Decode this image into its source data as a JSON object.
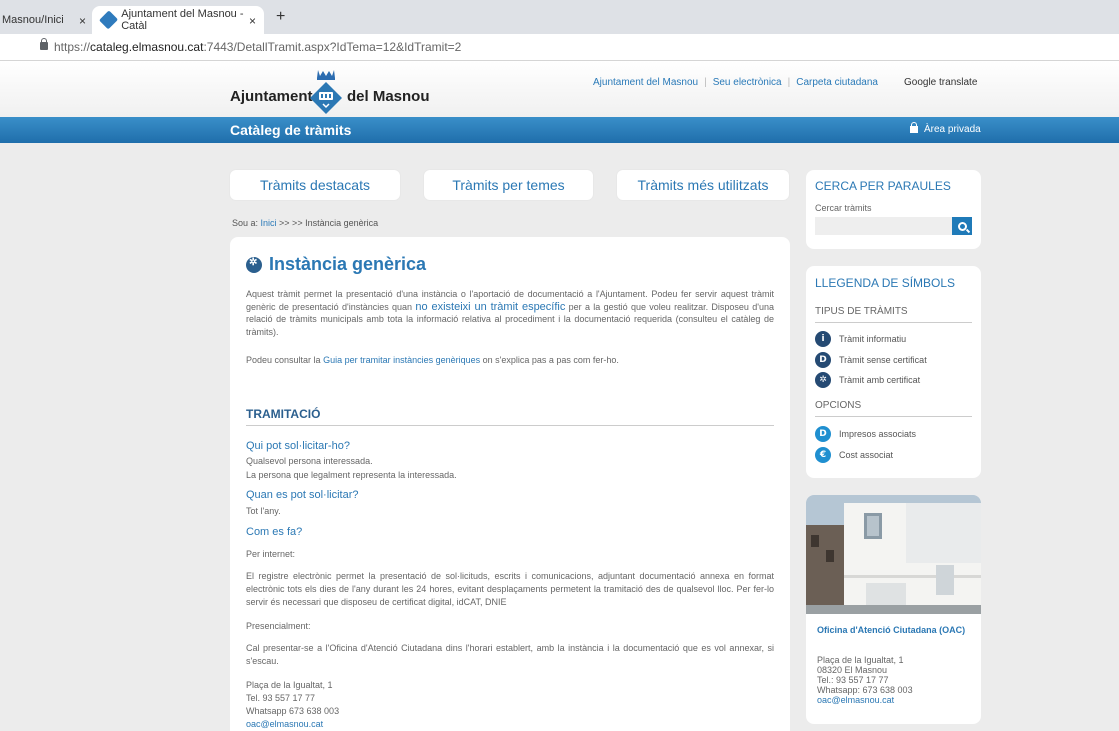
{
  "browser": {
    "tab1_title": "Masnou/Inici",
    "tab2_title": "Ajuntament del Masnou - Catàl",
    "close_glyph": "×",
    "new_tab_glyph": "+",
    "url_prefix": "https://",
    "url_host": "cataleg.elmasnou.cat",
    "url_rest": ":7443/DetallTramit.aspx?IdTema=12&IdTramit=2"
  },
  "header": {
    "logo_left": "Ajuntament",
    "logo_right": "del Masnou",
    "links": [
      "Ajuntament del Masnou",
      "Seu electrònica",
      "Carpeta ciutadana"
    ],
    "translate": "Google translate"
  },
  "bar": {
    "title": "Catàleg de tràmits",
    "private": "Àrea privada"
  },
  "nav": {
    "btn1": "Tràmits destacats",
    "btn2": "Tràmits per temes",
    "btn3": "Tràmits més utilitzats"
  },
  "breadcrumb": {
    "prefix": "Sou a: ",
    "home": "Inici",
    "rest": " >> >> Instància genèrica"
  },
  "main": {
    "title": "Instància genèrica",
    "intro_a": "Aquest tràmit permet la presentació d'una instància o l'aportació de documentació a l'Ajuntament. Podeu fer servir aquest tràmit genèric de presentació d'instàncies quan ",
    "intro_hl": "no existeixi un tràmit específic",
    "intro_b": " per a la gestió que voleu realitzar. Disposeu d'una relació de tràmits municipals amb tota la informació relativa al procediment i la documentació requerida (consulteu el catàleg de tràmits).",
    "intro2_a": "Podeu consultar la ",
    "intro2_link": "Guia per tramitar instàncies genèriques",
    "intro2_b": " on s'explica pas a pas com fer-ho.",
    "section": "TRAMITACIÓ",
    "q1": "Qui pot sol·licitar-ho?",
    "a1_line1": "Qualsevol persona interessada.",
    "a1_line2": "La persona que legalment representa la interessada.",
    "q2": "Quan es pot sol·licitar?",
    "a2": "Tot l'any.",
    "q3": "Com es fa?",
    "a3_internet": "Per internet:",
    "a3_internet_text": "El registre electrònic permet la presentació de sol·licituds, escrits i comunicacions, adjuntant documentació annexa en format electrònic tots els dies de l'any durant les 24 hores, evitant desplaçaments permetent la tramitació des de qualsevol lloc. Per fer-lo servir és necessari que disposeu de certificat digital, idCAT, DNIE",
    "a3_presencial": "Presencialment:",
    "a3_presencial_text": "Cal presentar-se a l'Oficina d'Atenció Ciutadana dins l'horari establert, amb la instància i la documentació que es vol annexar, si s'escau.",
    "addr1": "Plaça de la Igualtat, 1",
    "addr2": "Tel. 93 557 17 77",
    "addr3": "Whatsapp 673 638 003",
    "addr4": "oac@elmasnou.cat"
  },
  "search": {
    "heading": "CERCA PER PARAULES",
    "label": "Cercar tràmits",
    "placeholder": ""
  },
  "legend": {
    "heading": "LLEGENDA DE SÍMBOLS",
    "types_heading": "TIPUS DE TRÀMITS",
    "items": [
      {
        "icon": "info-icon",
        "glyph": "i",
        "label": "Tràmit informatiu"
      },
      {
        "icon": "document-icon",
        "glyph": "D",
        "label": "Tràmit sense certificat"
      },
      {
        "icon": "gear-icon",
        "glyph": "✲",
        "label": "Tràmit amb certificat"
      }
    ],
    "options_heading": "OPCIONS",
    "options": [
      {
        "icon": "forms-icon",
        "glyph": "D",
        "label": "Impresos associats"
      },
      {
        "icon": "euro-icon",
        "glyph": "€",
        "label": "Cost associat"
      }
    ]
  },
  "oac": {
    "title": "Oficina d'Atenció Ciutadana (OAC)",
    "line1": "Plaça de la Igualtat, 1",
    "line2": "08320 El Masnou",
    "line3": "Tel.: 93 557 17 77",
    "line4": "Whatsapp: 673 638 003",
    "email": "oac@elmasnou.cat"
  },
  "colors": {
    "brand_blue": "#2b78b4",
    "bar_blue": "#1f6eab",
    "dark_icon": "#254a73"
  }
}
